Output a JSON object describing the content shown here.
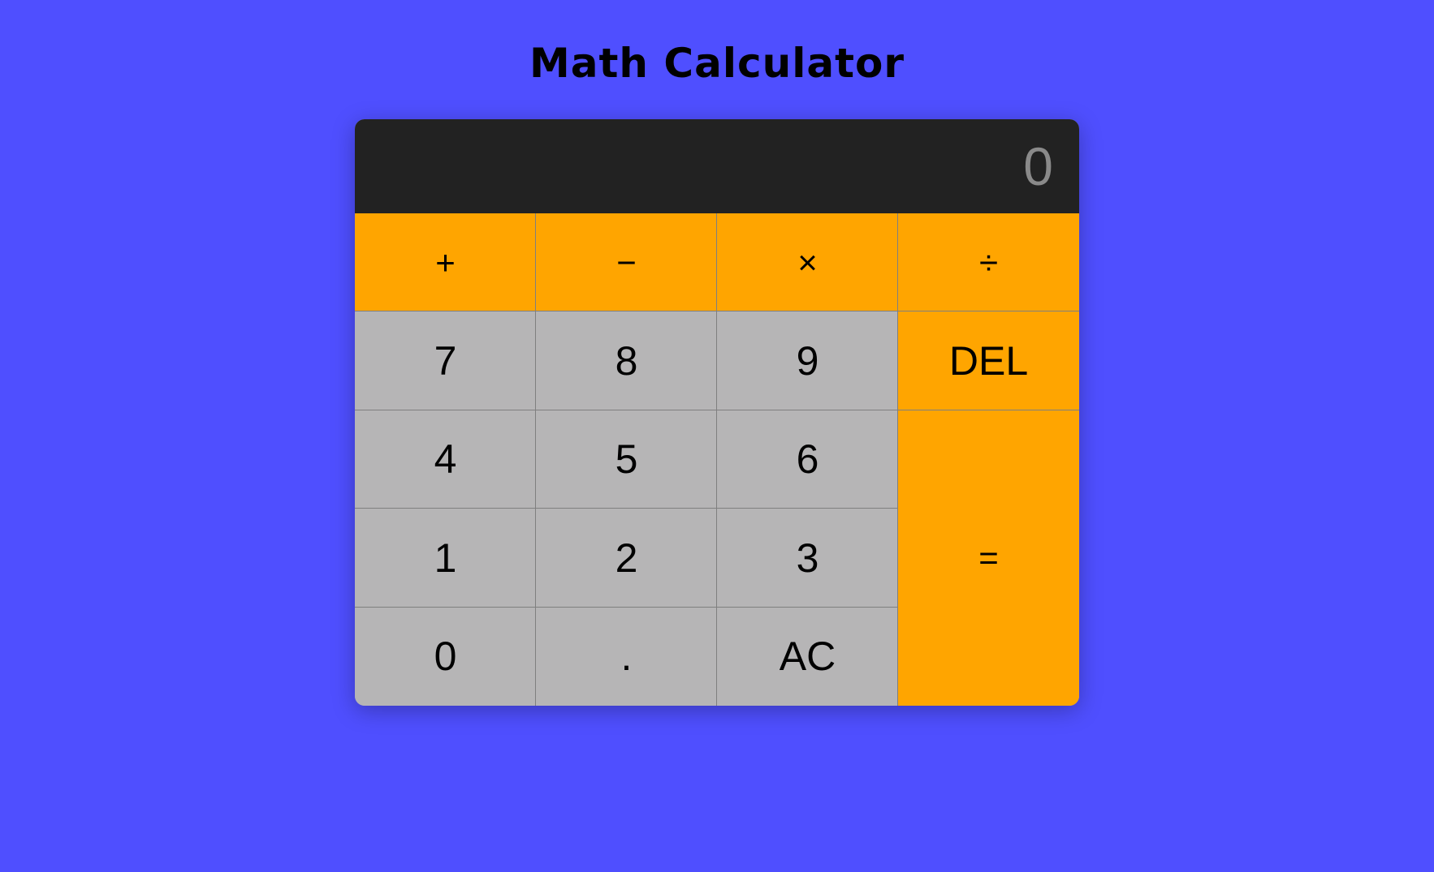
{
  "page": {
    "title": "Math Calculator"
  },
  "display": {
    "value": "0"
  },
  "keys": {
    "add": "+",
    "subtract": "−",
    "multiply": "×",
    "divide": "÷",
    "seven": "7",
    "eight": "8",
    "nine": "9",
    "delete": "DEL",
    "four": "4",
    "five": "5",
    "six": "6",
    "equals": "=",
    "one": "1",
    "two": "2",
    "three": "3",
    "zero": "0",
    "decimal": ".",
    "clear": "AC"
  },
  "colors": {
    "background": "#4f4fff",
    "display": "#222222",
    "display_text": "#8a8a8a",
    "operator": "#ffa500",
    "number": "#b6b5b6"
  }
}
